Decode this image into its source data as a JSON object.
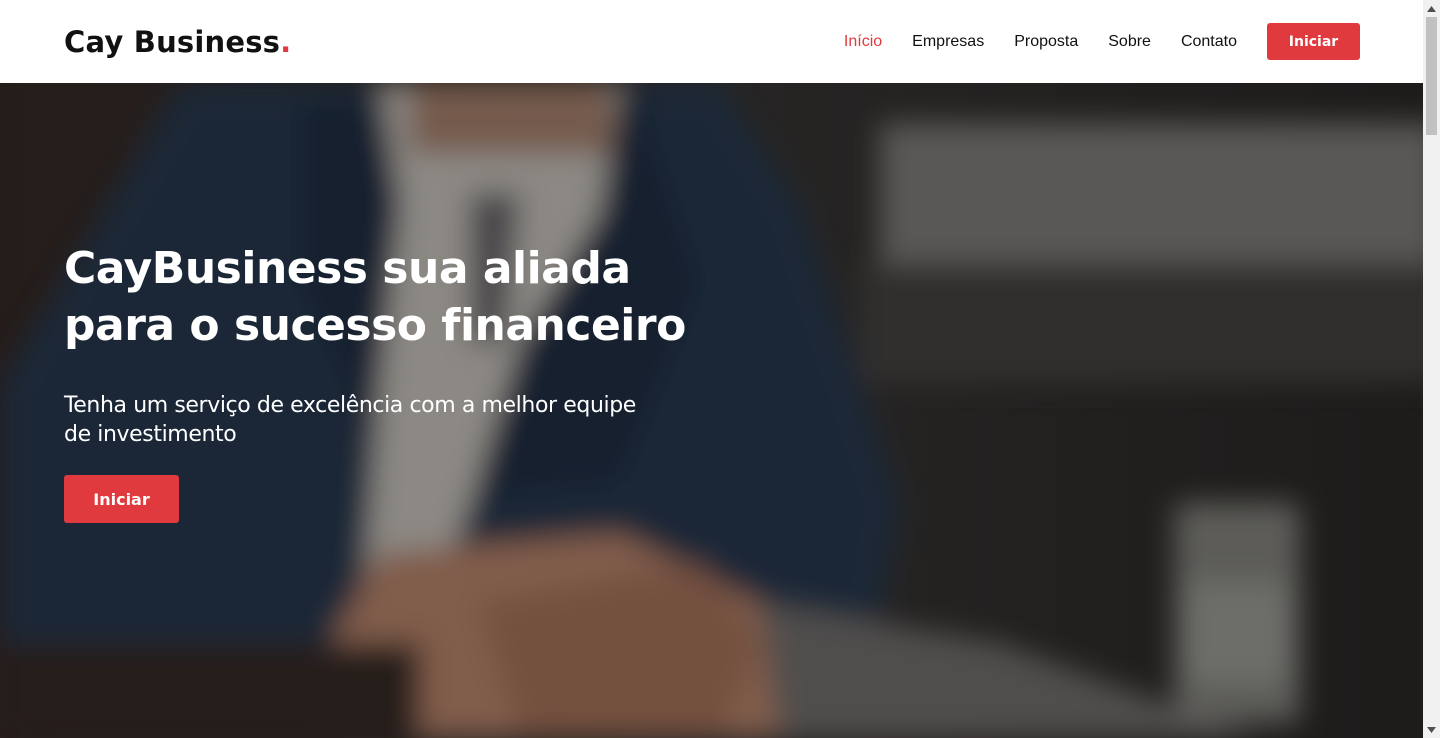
{
  "header": {
    "logo_text": "Cay Business",
    "logo_dot": ".",
    "nav": [
      {
        "label": "Início",
        "active": true
      },
      {
        "label": "Empresas",
        "active": false
      },
      {
        "label": "Proposta",
        "active": false
      },
      {
        "label": "Sobre",
        "active": false
      },
      {
        "label": "Contato",
        "active": false
      }
    ],
    "cta_label": "Iniciar"
  },
  "hero": {
    "title_line1": "CayBusiness sua aliada",
    "title_line2": "para o sucesso financeiro",
    "subtitle_line1": "Tenha um serviço de excelência com a melhor equipe",
    "subtitle_line2": "de investimento",
    "cta_label": "Iniciar",
    "background_image": "handshake-photo"
  },
  "colors": {
    "accent": "#e03a3e",
    "text_dark": "#111111",
    "hero_text": "#ffffff"
  },
  "icons": {
    "scroll_up": "chevron-up-icon",
    "scroll_down": "chevron-down-icon"
  }
}
